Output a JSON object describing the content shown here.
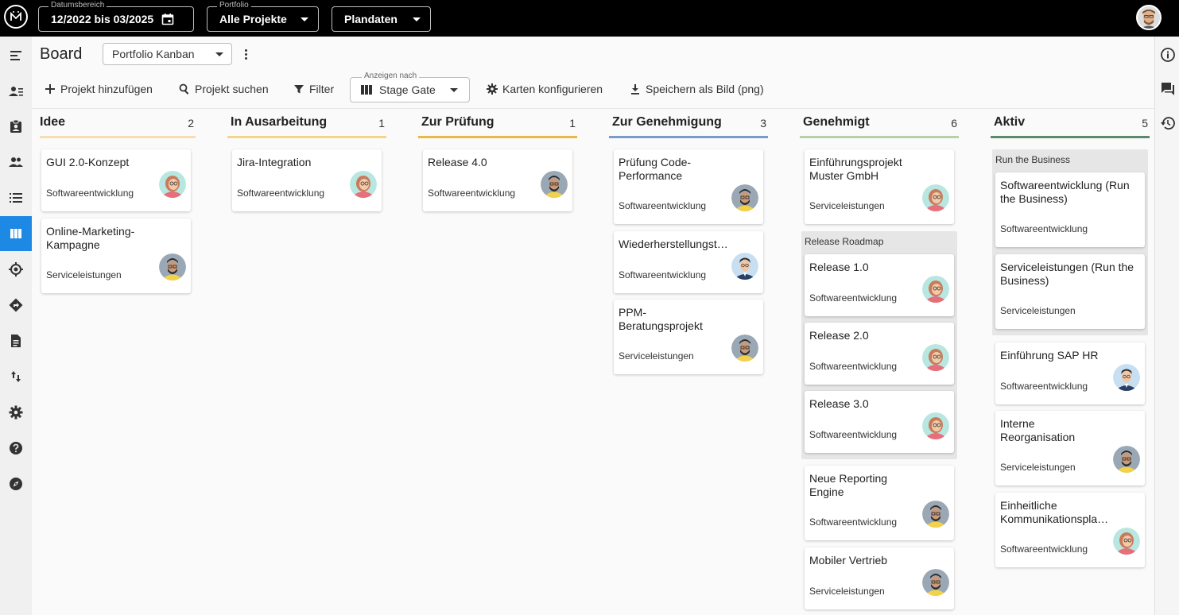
{
  "topbar": {
    "date_range": {
      "legend": "Datumsbereich",
      "value": "12/2022 bis 03/2025",
      "icon": "calendar-icon"
    },
    "portfolio": {
      "legend": "Portfolio",
      "value": "Alle Projekte"
    },
    "data_source": {
      "value": "Plandaten"
    }
  },
  "header": {
    "title": "Board",
    "view_select": "Portfolio Kanban"
  },
  "toolbar": {
    "add_project": "Projekt hinzufügen",
    "search_project": "Projekt suchen",
    "filter": "Filter",
    "group_by_legend": "Anzeigen nach",
    "group_by_value": "Stage Gate",
    "configure_cards": "Karten konfigurieren",
    "save_image": "Speichern als Bild (png)"
  },
  "colors": {
    "accent": "#1e88e5",
    "col_idee": "#f5deb3",
    "col_ausarbeitung": "#f2d78a",
    "col_pruefung": "#e8b84a",
    "col_genehmigung": "#7a9cc8",
    "col_genehmigt": "#b9cfa8",
    "col_aktiv": "#5a8a6a"
  },
  "columns": [
    {
      "title": "Idee",
      "count": "2",
      "cards": [
        {
          "title": "GUI 2.0-Konzept",
          "subtitle": "Softwareentwicklung",
          "avatar": "woman"
        },
        {
          "title": "Online-Marketing-Kampagne",
          "subtitle": "Serviceleistungen",
          "avatar": "man"
        }
      ]
    },
    {
      "title": "In Ausarbeitung",
      "count": "1",
      "cards": [
        {
          "title": "Jira-Integration",
          "subtitle": "Softwareentwicklung",
          "avatar": "woman"
        }
      ]
    },
    {
      "title": "Zur Prüfung",
      "count": "1",
      "cards": [
        {
          "title": "Release 4.0",
          "subtitle": "Softwareentwicklung",
          "avatar": "man"
        }
      ]
    },
    {
      "title": "Zur Genehmigung",
      "count": "3",
      "cards": [
        {
          "title": "Prüfung Code-Performance",
          "subtitle": "Softwareentwicklung",
          "avatar": "man"
        },
        {
          "title": "Wiederherstellungst…",
          "subtitle": "Softwareentwicklung",
          "avatar": "suit"
        },
        {
          "title": "PPM-Beratungsprojekt",
          "subtitle": "Serviceleistungen",
          "avatar": "man"
        }
      ]
    },
    {
      "title": "Genehmigt",
      "count": "6",
      "cards": [
        {
          "title": "Einführungsprojekt Muster GmbH",
          "subtitle": "Serviceleistungen",
          "avatar": "woman"
        },
        {
          "title": "Release 1.0",
          "subtitle": "Softwareentwicklung",
          "avatar": "woman"
        },
        {
          "title": "Release 2.0",
          "subtitle": "Softwareentwicklung",
          "avatar": "woman"
        },
        {
          "title": "Release 3.0",
          "subtitle": "Softwareentwicklung",
          "avatar": "woman"
        },
        {
          "title": "Neue Reporting Engine",
          "subtitle": "Softwareentwicklung",
          "avatar": "man"
        },
        {
          "title": "Mobiler Vertrieb",
          "subtitle": "Serviceleistungen",
          "avatar": "man"
        }
      ],
      "group_label": "Release Roadmap"
    },
    {
      "title": "Aktiv",
      "count": "5",
      "cards": [
        {
          "title": "Softwareentwicklung (Run the Business)",
          "subtitle": "Softwareentwicklung",
          "avatar": "none"
        },
        {
          "title": "Serviceleistungen (Run the Business)",
          "subtitle": "Serviceleistungen",
          "avatar": "none"
        },
        {
          "title": "Einführung SAP HR",
          "subtitle": "Softwareentwicklung",
          "avatar": "suit"
        },
        {
          "title": "Interne Reorganisation",
          "subtitle": "Serviceleistungen",
          "avatar": "man"
        },
        {
          "title": "Einheitliche Kommunikationspla…",
          "subtitle": "Softwareentwicklung",
          "avatar": "woman"
        }
      ],
      "group_label": "Run the Business"
    }
  ],
  "leftnav_icons": [
    "menu-icon",
    "people-list-icon",
    "badge-icon",
    "team-icon",
    "list-icon",
    "board-icon",
    "target-icon",
    "roadmap-icon",
    "document-icon",
    "sort-icon",
    "settings-icon",
    "help-icon",
    "compass-icon"
  ],
  "rightnav_icons": [
    "info-icon",
    "chat-icon",
    "history-icon"
  ]
}
